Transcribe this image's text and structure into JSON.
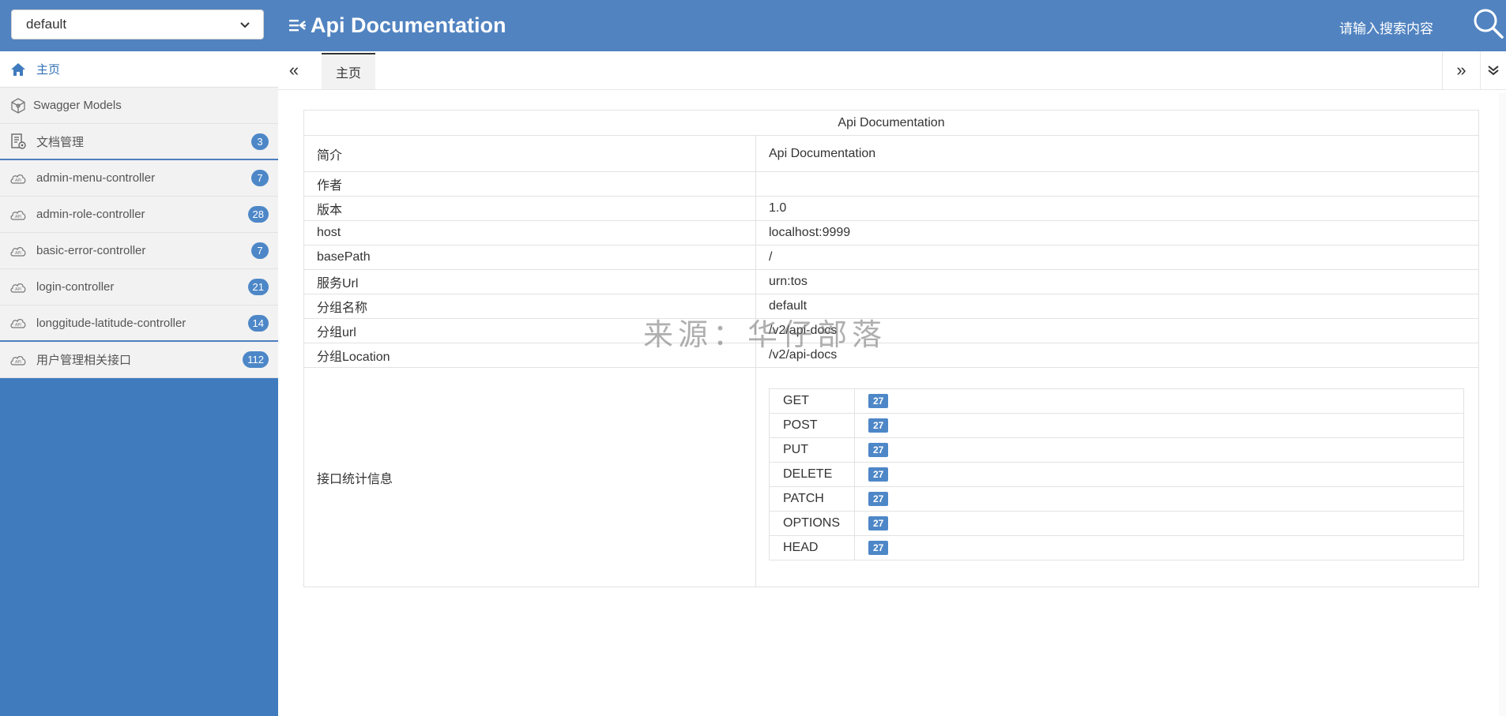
{
  "header": {
    "group_select_value": "default",
    "title": "Api Documentation",
    "search_placeholder": "请输入搜索内容",
    "colors": {
      "header_bg": "#5183c0",
      "sidebar_bg": "#3f7bbd",
      "badge": "#4d87c7"
    }
  },
  "sidebar": {
    "items": [
      {
        "label": "主页",
        "icon": "home-icon"
      },
      {
        "label": "Swagger Models",
        "icon": "models-icon"
      },
      {
        "label": "文档管理",
        "icon": "doc-settings-icon",
        "badge": "3"
      },
      {
        "label": "admin-menu-controller",
        "icon": "api-cloud-icon",
        "badge": "7"
      },
      {
        "label": "admin-role-controller",
        "icon": "api-cloud-icon",
        "badge": "28"
      },
      {
        "label": "basic-error-controller",
        "icon": "api-cloud-icon",
        "badge": "7"
      },
      {
        "label": "login-controller",
        "icon": "api-cloud-icon",
        "badge": "21"
      },
      {
        "label": "longgitude-latitude-controller",
        "icon": "api-cloud-icon",
        "badge": "14"
      },
      {
        "label": "用户管理相关接口",
        "icon": "api-cloud-icon",
        "badge": "112"
      }
    ]
  },
  "tabs": {
    "active_label": "主页",
    "prev_glyph": "«",
    "next_glyph": "»"
  },
  "info": {
    "table_title": "Api Documentation",
    "rows": [
      {
        "key": "简介",
        "value": "Api Documentation"
      },
      {
        "key": "作者",
        "value": ""
      },
      {
        "key": "版本",
        "value": "1.0"
      },
      {
        "key": "host",
        "value": "localhost:9999"
      },
      {
        "key": "basePath",
        "value": "/"
      },
      {
        "key": "服务Url",
        "value": "urn:tos"
      },
      {
        "key": "分组名称",
        "value": "default"
      },
      {
        "key": "分组url",
        "value": "/v2/api-docs"
      },
      {
        "key": "分组Location",
        "value": "/v2/api-docs"
      }
    ],
    "stats_label": "接口统计信息",
    "stats": [
      {
        "method": "GET",
        "count": "27"
      },
      {
        "method": "POST",
        "count": "27"
      },
      {
        "method": "PUT",
        "count": "27"
      },
      {
        "method": "DELETE",
        "count": "27"
      },
      {
        "method": "PATCH",
        "count": "27"
      },
      {
        "method": "OPTIONS",
        "count": "27"
      },
      {
        "method": "HEAD",
        "count": "27"
      }
    ]
  },
  "watermark": "来源：华仔部落"
}
